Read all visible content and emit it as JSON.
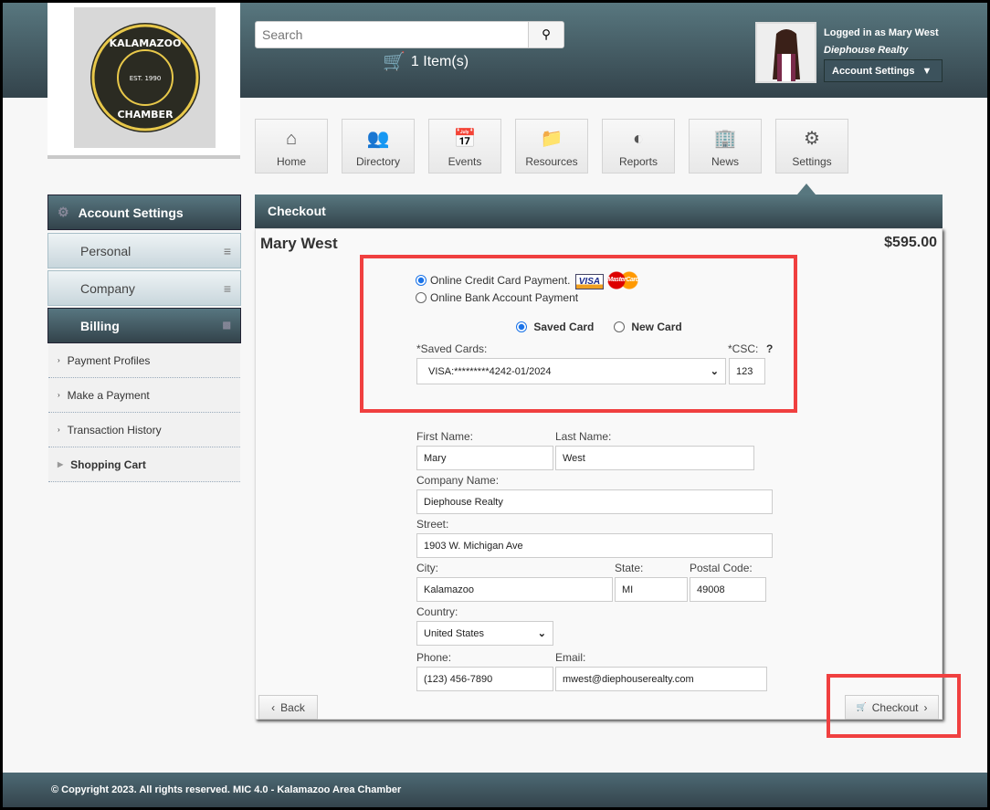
{
  "header": {
    "logo": {
      "top": "KALAMAZOO",
      "est": "EST. 1990",
      "bottom": "CHAMBER"
    },
    "search_placeholder": "Search",
    "cart": "1 Item(s)",
    "logged_in": "Logged in as Mary West",
    "company": "Diephouse Realty",
    "account_settings": "Account Settings"
  },
  "nav": [
    {
      "label": "Home",
      "icon": "home-icon"
    },
    {
      "label": "Directory",
      "icon": "people-icon"
    },
    {
      "label": "Events",
      "icon": "calendar-icon"
    },
    {
      "label": "Resources",
      "icon": "folder-icon"
    },
    {
      "label": "Reports",
      "icon": "chart-icon"
    },
    {
      "label": "News",
      "icon": "building-icon"
    },
    {
      "label": "Settings",
      "icon": "gear-icon"
    }
  ],
  "sidebar": {
    "title": "Account Settings",
    "sections": [
      "Personal",
      "Company",
      "Billing"
    ],
    "billing_items": [
      "Payment Profiles",
      "Make a Payment",
      "Transaction History",
      "Shopping Cart"
    ]
  },
  "checkout": {
    "title": "Checkout",
    "name": "Mary West",
    "total": "$595.00",
    "pay_credit": "Online Credit Card Payment.",
    "pay_bank": "Online Bank Account Payment",
    "saved_card": "Saved Card",
    "new_card": "New Card",
    "saved_cards_label": "*Saved Cards:",
    "saved_card_value": "VISA:*********4242-01/2024",
    "csc_label": "*CSC:",
    "csc_help": "?",
    "csc_value": "123",
    "visa": "VISA",
    "mastercard": "MasterCard",
    "fields": {
      "first_name_label": "First Name:",
      "first_name": "Mary",
      "last_name_label": "Last Name:",
      "last_name": "West",
      "company_label": "Company Name:",
      "company": "Diephouse Realty",
      "street_label": "Street:",
      "street": "1903 W. Michigan Ave",
      "city_label": "City:",
      "city": "Kalamazoo",
      "state_label": "State:",
      "state": "MI",
      "postal_label": "Postal Code:",
      "postal": "49008",
      "country_label": "Country:",
      "country": "United States",
      "phone_label": "Phone:",
      "phone": "(123) 456-7890",
      "email_label": "Email:",
      "email": "mwest@diephouserealty.com"
    },
    "back": "Back",
    "checkout_btn": "Checkout"
  },
  "footer": "© Copyright 2023. All rights reserved. MIC 4.0 - Kalamazoo Area Chamber"
}
